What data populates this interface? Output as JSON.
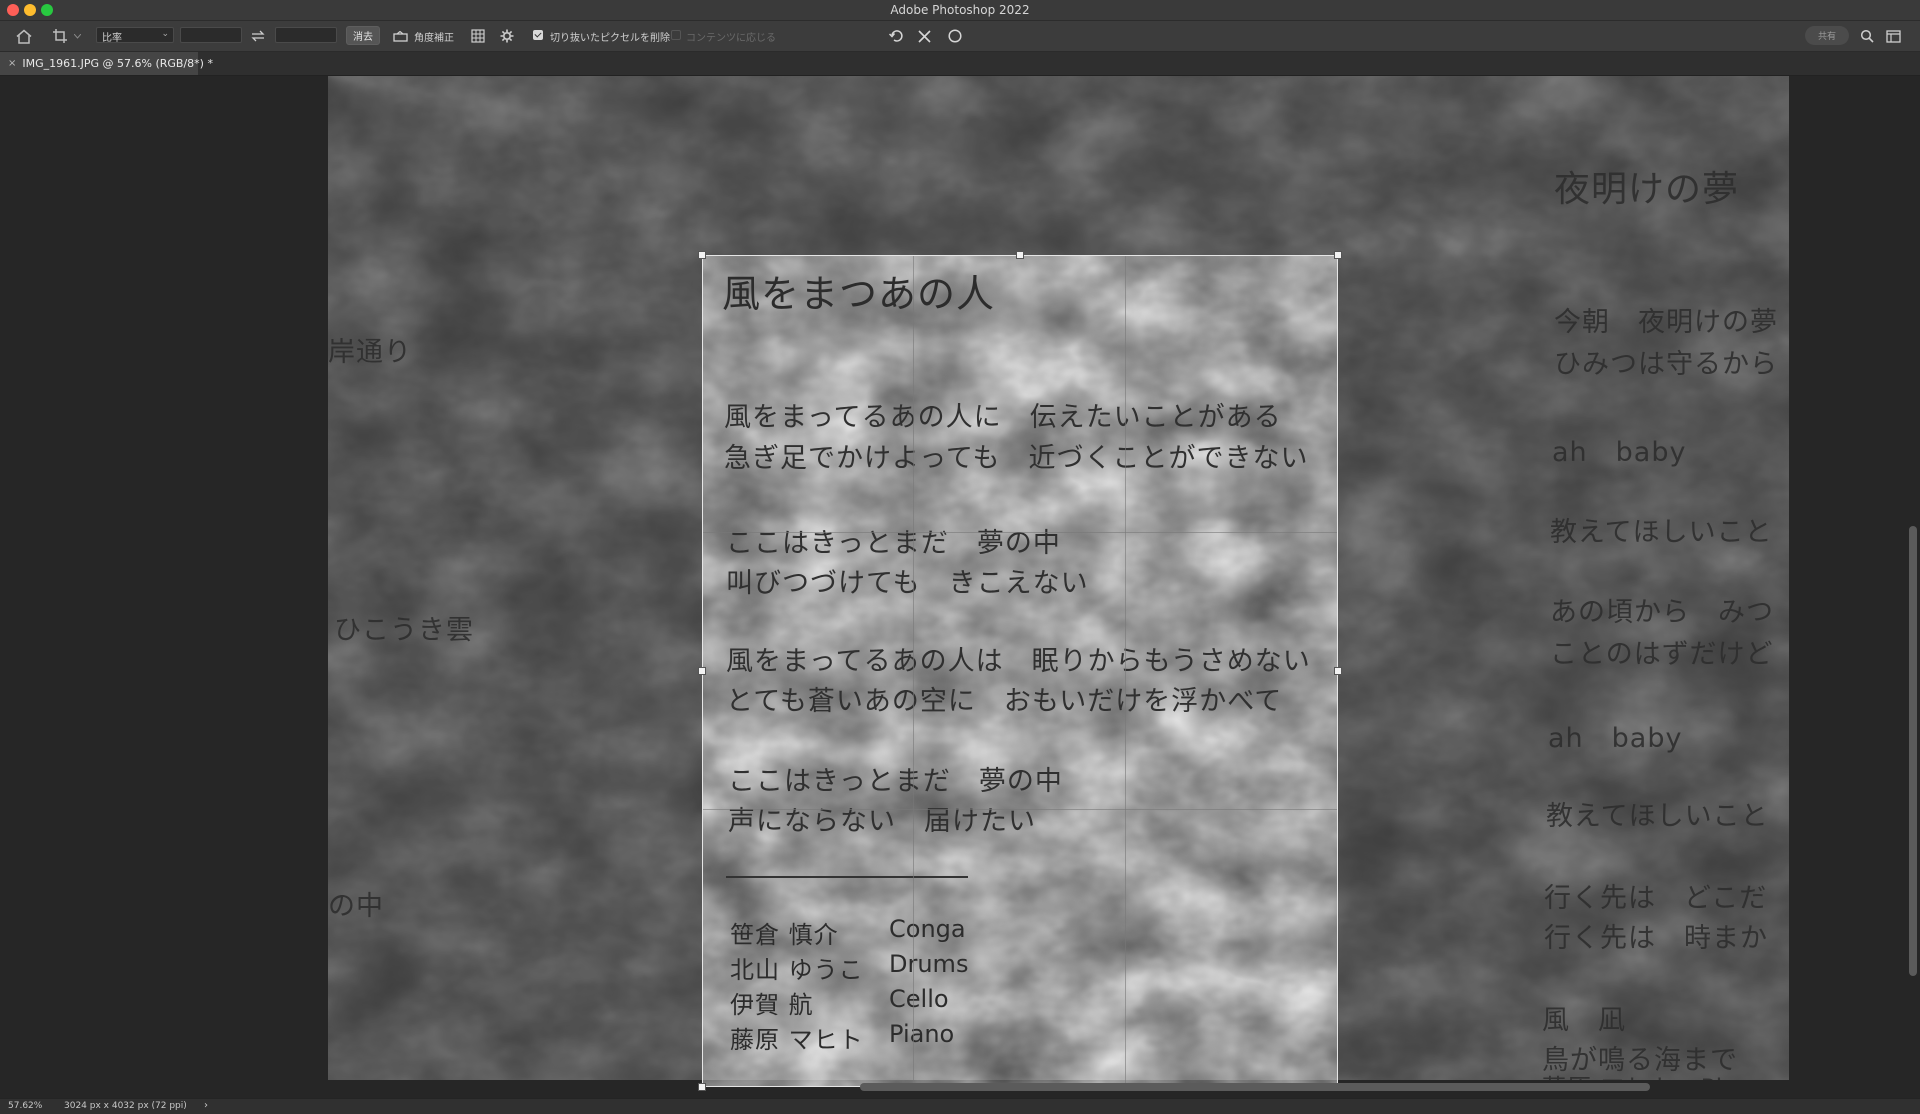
{
  "window": {
    "title": "Adobe Photoshop 2022"
  },
  "options_bar": {
    "ratio_select": "比率",
    "width_value": "",
    "height_value": "",
    "clear_label": "消去",
    "straighten_label": "角度補正",
    "delete_cropped_label": "切り抜いたピクセルを削除",
    "delete_cropped_checked": true,
    "content_aware_label": "コンテンツに応じる",
    "content_aware_checked": false,
    "share_label": "共有"
  },
  "document_tab": {
    "close_glyph": "×",
    "label": "IMG_1961.JPG @ 57.6% (RGB/8*) *"
  },
  "document": {
    "song_title": "風をまつあの人",
    "lyrics": [
      "風をまってるあの人に　伝えたいことがある",
      "急ぎ足でかけよっても　近づくことができない",
      "ここはきっとまだ　夢の中",
      "叫びつづけても　きこえない",
      "風をまってるあの人は　眠りからもうさめない",
      "とても蒼いあの空に　おもいだけを浮かべて",
      "ここはきっとまだ　夢の中",
      "声にならない　届けたい"
    ],
    "credits": [
      {
        "name": "笹倉 慎介",
        "instrument": "Conga"
      },
      {
        "name": "北山 ゆうこ",
        "instrument": "Drums"
      },
      {
        "name": "伊賀 航",
        "instrument": "Cello"
      },
      {
        "name": "藤原 マヒト",
        "instrument": "Piano"
      }
    ],
    "left_page_fragments": [
      "岸通り",
      "ひこうき雲",
      "の中"
    ],
    "right_page": {
      "title": "夜明けの夢",
      "lines": [
        "今朝　夜明けの夢",
        "ひみつは守るから",
        "ah　baby",
        "教えてほしいこと",
        "あの頃から　みつ",
        "ことのはずだけど",
        "ah　baby",
        "教えてほしいこと",
        "行く先は　どこだ",
        "行く先は　時まか",
        "風　凪",
        "鳥が鳴る海まで",
        "藤原 マヒト　Piano"
      ]
    }
  },
  "status_bar": {
    "zoom": "57.62%",
    "dimensions": "3024 px x 4032 px (72 ppi)",
    "arrow": "›"
  },
  "colors": {
    "crop_border": "#e6e6e6",
    "traffic_close": "#fe5f57",
    "traffic_min": "#febc2e",
    "traffic_max": "#28c840"
  }
}
